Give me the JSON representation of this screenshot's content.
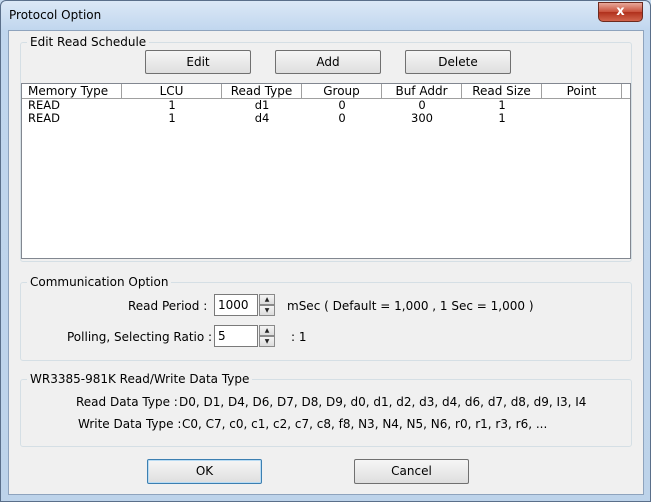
{
  "window": {
    "title": "Protocol Option",
    "close_glyph": "x"
  },
  "schedule": {
    "legend": "Edit Read Schedule",
    "buttons": {
      "edit": "Edit",
      "add": "Add",
      "delete": "Delete"
    },
    "columns": [
      "Memory Type",
      "LCU",
      "Read Type",
      "Group",
      "Buf Addr",
      "Read Size",
      "Point"
    ],
    "rows": [
      [
        "READ",
        "1",
        "d1",
        "0",
        "0",
        "1",
        ""
      ],
      [
        "READ",
        "1",
        "d4",
        "0",
        "300",
        "1",
        ""
      ]
    ]
  },
  "communication": {
    "legend": "Communication Option",
    "read_period_label": "Read Period :",
    "read_period_value": "1000",
    "read_period_note": "mSec ( Default = 1,000 ,    1 Sec = 1,000 )",
    "polling_label": "Polling, Selecting Ratio :",
    "polling_value": "5",
    "polling_suffix": ":   1"
  },
  "datatype": {
    "legend": "WR3385-981K Read/Write Data Type",
    "read_label": "Read Data Type :",
    "read_value": "D0, D1, D4, D6, D7, D8, D9, d0, d1, d2, d3, d4, d6, d7, d8, d9, I3, I4",
    "write_label": "Write Data Type :",
    "write_value": "C0, C7, c0, c1, c2, c7, c8, f8,  N3, N4, N5, N6, r0, r1, r3, r6, ..."
  },
  "footer": {
    "ok": "OK",
    "cancel": "Cancel"
  },
  "icons": {
    "spin_up": "up-arrow-icon",
    "spin_down": "down-arrow-icon",
    "close": "close-icon"
  }
}
